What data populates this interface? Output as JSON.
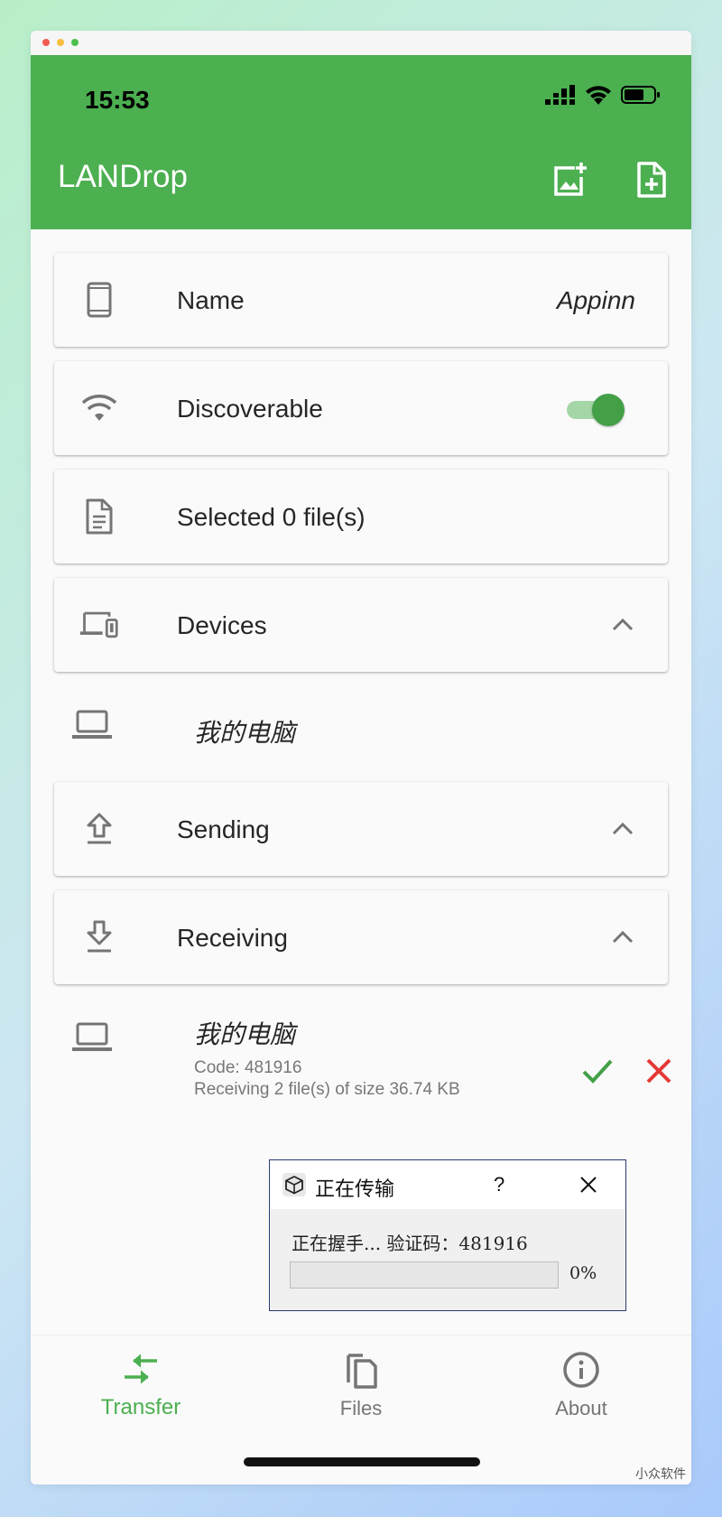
{
  "status_bar": {
    "time": "15:53"
  },
  "app_bar": {
    "title": "LANDrop"
  },
  "cards": {
    "name": {
      "label": "Name",
      "value": "Appinn"
    },
    "discoverable": {
      "label": "Discoverable",
      "enabled": true
    },
    "selected": {
      "label": "Selected 0 file(s)"
    },
    "devices": {
      "label": "Devices"
    },
    "sending": {
      "label": "Sending"
    },
    "receiving": {
      "label": "Receiving"
    }
  },
  "devices_list": [
    {
      "name": "我的电脑"
    }
  ],
  "receiving_list": [
    {
      "name": "我的电脑",
      "code": "Code: 481916",
      "info": "Receiving 2 file(s) of size 36.74 KB"
    }
  ],
  "dialog": {
    "title": "正在传输",
    "help": "?",
    "message": "正在握手... 验证码：481916",
    "progress_percent": 0,
    "progress_label": "0%"
  },
  "bottom_nav": [
    {
      "label": "Transfer",
      "active": true
    },
    {
      "label": "Files",
      "active": false
    },
    {
      "label": "About",
      "active": false
    }
  ],
  "watermark": "小众软件",
  "colors": {
    "primary": "#4caf50",
    "accept": "#43a047",
    "reject": "#e53935"
  }
}
